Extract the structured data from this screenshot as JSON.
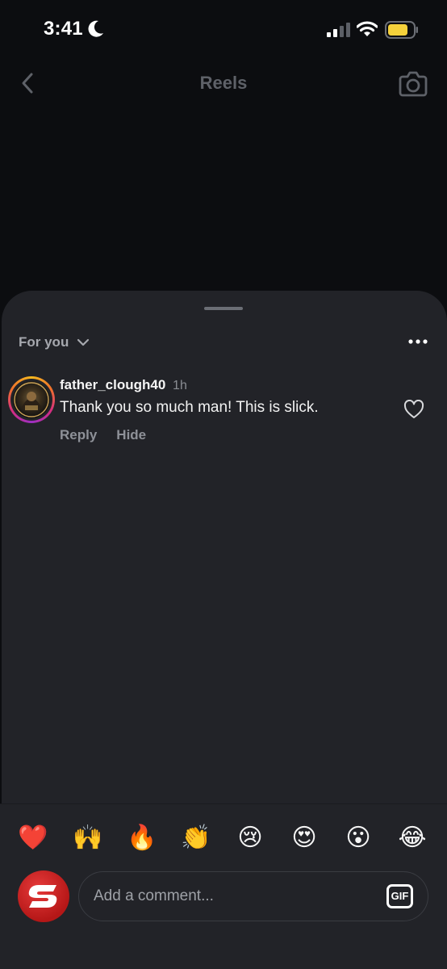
{
  "status_bar": {
    "time": "3:41"
  },
  "nav": {
    "title": "Reels",
    "back_icon": "chevron-left-icon",
    "camera_icon": "camera-icon"
  },
  "sheet": {
    "sort_label": "For you",
    "comments": [
      {
        "username": "father_clough40",
        "time": "1h",
        "text": "Thank you so much man! This is slick.",
        "reply_label": "Reply",
        "hide_label": "Hide"
      }
    ]
  },
  "composer": {
    "emojis": [
      "❤️",
      "🙌",
      "🔥",
      "👏",
      "😢",
      "😍",
      "😮",
      "😂"
    ],
    "placeholder": "Add a comment...",
    "gif_label": "GIF"
  },
  "colors": {
    "background": "#0c0d10",
    "sheet": "#222328",
    "muted_text": "#8e9198"
  }
}
